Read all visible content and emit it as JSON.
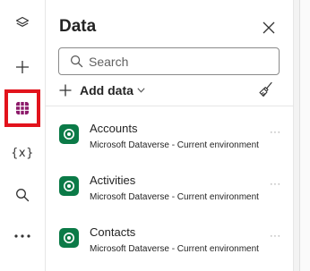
{
  "rail": {
    "items": [
      {
        "name": "tree-view",
        "icon": "layers-icon",
        "selected": false
      },
      {
        "name": "insert",
        "icon": "plus-icon",
        "selected": false
      },
      {
        "name": "data",
        "icon": "data-grid-icon",
        "selected": true
      },
      {
        "name": "variables",
        "icon": "variables-icon",
        "label": "{x}",
        "selected": false
      },
      {
        "name": "search",
        "icon": "search-icon",
        "selected": false
      },
      {
        "name": "more",
        "icon": "more-icon",
        "selected": false
      }
    ],
    "selected_color": "#e2131c"
  },
  "panel": {
    "title": "Data",
    "search": {
      "placeholder": "Search",
      "value": ""
    },
    "add_data_label": "Add data",
    "items": [
      {
        "name": "Accounts",
        "source": "Microsoft Dataverse - Current environment"
      },
      {
        "name": "Activities",
        "source": "Microsoft Dataverse - Current environment"
      },
      {
        "name": "Contacts",
        "source": "Microsoft Dataverse - Current environment"
      }
    ],
    "item_icon": "dataverse-icon",
    "item_icon_color": "#0b7a47"
  }
}
